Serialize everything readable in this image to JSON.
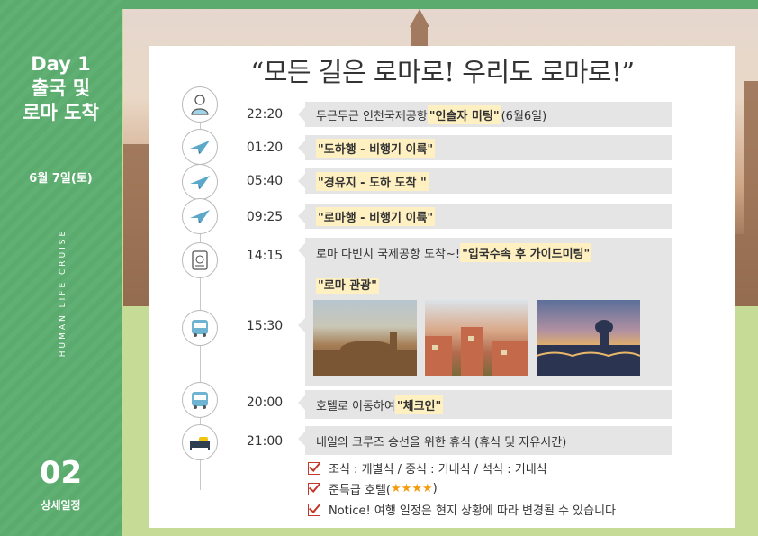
{
  "left_panel": {
    "day_title_lines": [
      "Day 1",
      "출국 및",
      "로마 도착"
    ],
    "date": "6월 7일(토)",
    "vertical_text": "HUMAN LIFE CRUISE",
    "section_number": "02",
    "section_label": "상세일정"
  },
  "headline": "“모든 길은 로마로! 우리도 로마로!”",
  "schedule": [
    {
      "time": "22:20",
      "icon": "person-icon",
      "text_before": "두근두근 인천국제공항 ",
      "highlight": "\"인솔자 미팅\"",
      "text_after": " (6월6일)"
    },
    {
      "time": "01:20",
      "icon": "plane-icon",
      "text_before": "",
      "highlight": "\"도하행 - 비행기 이륙\"",
      "text_after": ""
    },
    {
      "time": "05:40",
      "icon": "plane-icon",
      "text_before": "",
      "highlight": "\"경유지 - 도하 도착 \"",
      "text_after": ""
    },
    {
      "time": "09:25",
      "icon": "plane-icon",
      "text_before": "",
      "highlight": "\"로마행 - 비행기 이륙\"",
      "text_after": ""
    },
    {
      "time": "14:15",
      "icon": "passport-icon",
      "text_before": "로마 다빈치 국제공항 도착~! ",
      "highlight": "\"입국수속 후 가이드미팅\"",
      "text_after": ""
    },
    {
      "time": "15:30",
      "icon": "bus-icon",
      "text_before": "",
      "highlight": "\"로마 관광\"",
      "text_after": ""
    },
    {
      "time": "20:00",
      "icon": "bus-icon",
      "text_before": "호텔로 이동하여 ",
      "highlight": "\"체크인\"",
      "text_after": ""
    },
    {
      "time": "21:00",
      "icon": "bed-icon",
      "text_before": "내일의 크루즈 승선을 위한 휴식 (휴식 및 자유시간)",
      "highlight": "",
      "text_after": ""
    }
  ],
  "notes": [
    {
      "text": "조식 : 개별식   /   중식 : 기내식    /   석식 : 기내식"
    },
    {
      "text": "준특급 호텔(",
      "stars": "★★★★",
      "text_after": ")"
    },
    {
      "text": "Notice!  여행 일정은 현지 상황에 따라 변경될 수 있습니다"
    }
  ],
  "colors": {
    "green": "#5cab6e",
    "light_green": "#c6dc96",
    "bar_gray": "#e6e5e5",
    "highlight": "#fff0c2",
    "check_red": "#c0392b",
    "star": "#f39c12"
  }
}
